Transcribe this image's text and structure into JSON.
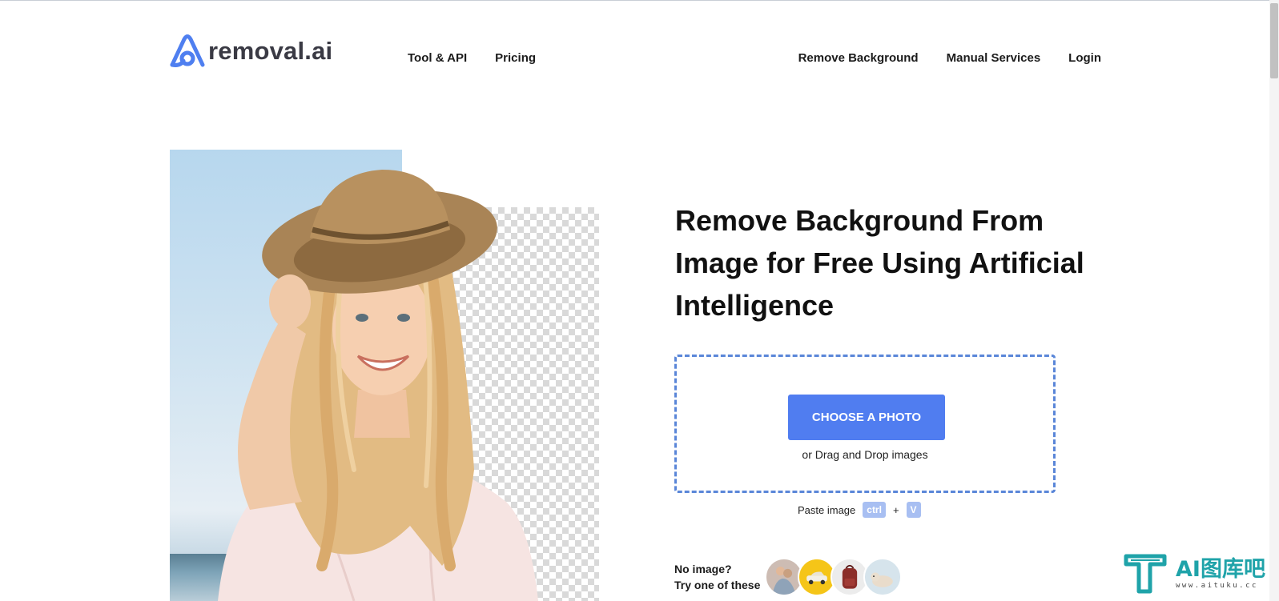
{
  "brand": {
    "name": "removal.ai",
    "accent": "#507df0"
  },
  "nav": {
    "left": [
      {
        "label": "Tool & API"
      },
      {
        "label": "Pricing"
      }
    ],
    "right": [
      {
        "label": "Remove Background"
      },
      {
        "label": "Manual Services"
      },
      {
        "label": "Login"
      }
    ]
  },
  "hero": {
    "headline": "Remove Background From Image for Free Using Artificial Intelligence"
  },
  "upload": {
    "button_label": "CHOOSE A PHOTO",
    "drag_text": "or Drag and Drop images",
    "paste_label": "Paste image",
    "key_ctrl": "ctrl",
    "plus": "+",
    "key_v": "V"
  },
  "samples": {
    "line1": "No image?",
    "line2": "Try one of these",
    "items": [
      {
        "icon": "couple-photo"
      },
      {
        "icon": "car-photo"
      },
      {
        "icon": "backpack-photo"
      },
      {
        "icon": "dog-photo"
      }
    ]
  },
  "watermark": {
    "title": "AI图库吧",
    "subtitle": "www.aituku.cc"
  }
}
